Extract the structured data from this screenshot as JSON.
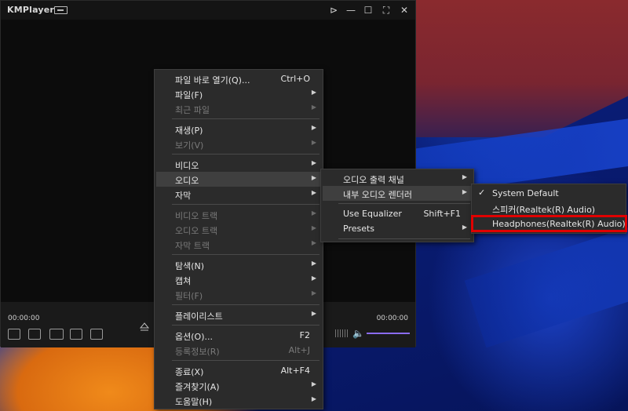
{
  "app": {
    "title": "KMPlayer"
  },
  "window_controls": {
    "pin": "⊳",
    "minimize": "—",
    "maximize": "☐",
    "fullscreen": "⛶",
    "close": "✕"
  },
  "player": {
    "time_left": "00:00:00",
    "time_right": "00:00:00"
  },
  "main_menu": {
    "items": [
      {
        "label": "파일 바로 열기(Q)...",
        "shortcut": "Ctrl+O"
      },
      {
        "label": "파일(F)"
      },
      {
        "label": "최근 파일"
      },
      {
        "label": "재생(P)"
      },
      {
        "label": "보기(V)"
      },
      {
        "label": "비디오"
      },
      {
        "label": "오디오"
      },
      {
        "label": "자막"
      },
      {
        "label": "비디오 트랙"
      },
      {
        "label": "오디오 트랙"
      },
      {
        "label": "자막 트랙"
      },
      {
        "label": "탐색(N)"
      },
      {
        "label": "캡쳐"
      },
      {
        "label": "필터(F)"
      },
      {
        "label": "플레이리스트"
      },
      {
        "label": "옵션(O)...",
        "shortcut": "F2"
      },
      {
        "label": "등록정보(R)",
        "shortcut": "Alt+J"
      },
      {
        "label": "종료(X)",
        "shortcut": "Alt+F4"
      },
      {
        "label": "즐겨찾기(A)"
      },
      {
        "label": "도움말(H)"
      }
    ]
  },
  "audio_menu": {
    "items": [
      {
        "label": "오디오 출력 채널"
      },
      {
        "label": "내부 오디오 렌더러"
      },
      {
        "label": "Use Equalizer",
        "shortcut": "Shift+F1"
      },
      {
        "label": "Presets"
      }
    ]
  },
  "renderer_menu": {
    "items": [
      {
        "label": "System Default",
        "checked": true
      },
      {
        "label": "스피커(Realtek(R) Audio)"
      },
      {
        "label": "Headphones(Realtek(R) Audio)"
      }
    ]
  },
  "colors": {
    "menu_bg": "#2b2b2b",
    "highlight": "#3f3f3f",
    "red_outline": "#e00000",
    "volume": "#8a6cf0"
  }
}
